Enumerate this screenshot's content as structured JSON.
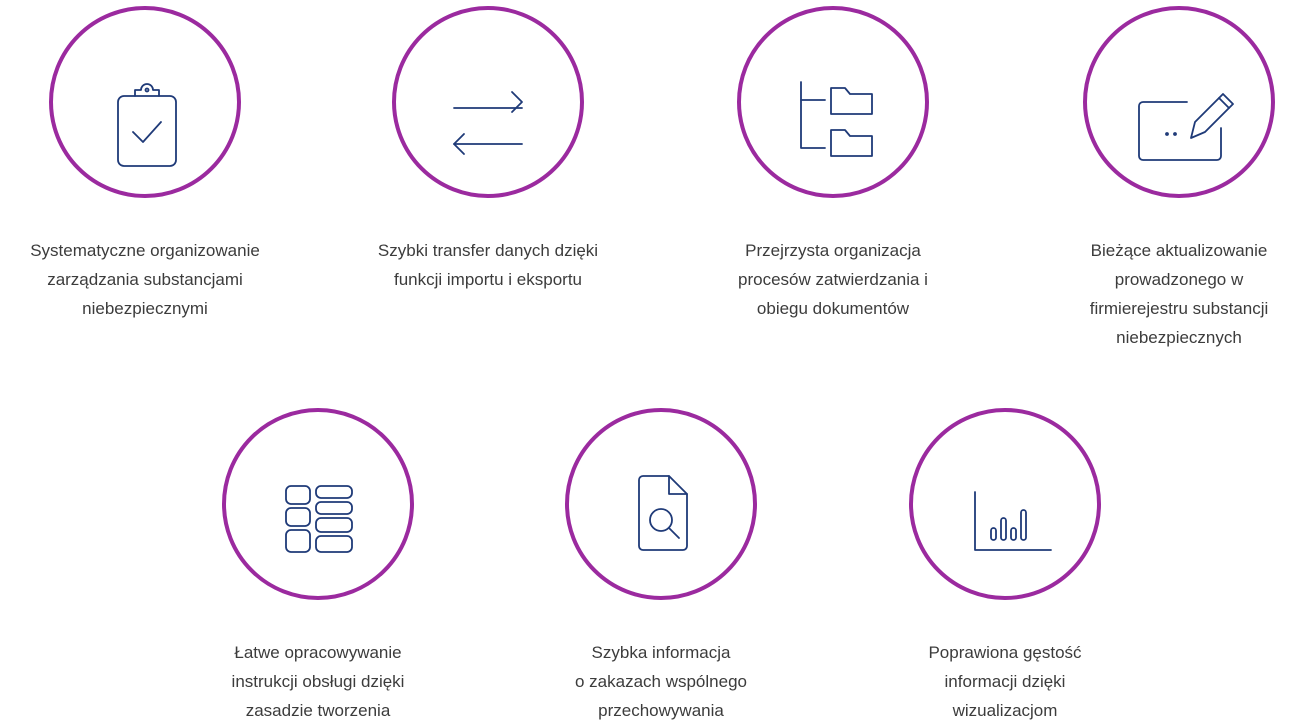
{
  "features": [
    {
      "icon": "clipboard-check-icon",
      "lines": [
        "Systematyczne organizowanie",
        "zarządzania substancjami",
        "niebezpiecznymi"
      ]
    },
    {
      "icon": "transfer-arrows-icon",
      "lines": [
        "Szybki transfer danych dzięki",
        "funkcji importu i eksportu"
      ]
    },
    {
      "icon": "folder-tree-icon",
      "lines": [
        "Przejrzysta organizacja",
        "procesów zatwierdzania i",
        "obiegu dokumentów"
      ]
    },
    {
      "icon": "edit-pencil-icon",
      "lines": [
        "Bieżące aktualizowanie",
        "prowadzonego w",
        "firmierejestru substancji",
        "niebezpiecznych"
      ]
    },
    {
      "icon": "layout-grid-icon",
      "lines": [
        "Łatwe opracowywanie",
        "instrukcji obsługi dzięki",
        "zasadzie tworzenia"
      ]
    },
    {
      "icon": "document-search-icon",
      "lines": [
        "Szybka informacja",
        "o zakazach wspólnego",
        "przechowywania"
      ]
    },
    {
      "icon": "bar-chart-icon",
      "lines": [
        "Poprawiona gęstość",
        "informacji dzięki",
        "wizualizacjom"
      ]
    }
  ],
  "colors": {
    "ring": "#9b2a9f",
    "icon": "#1f3a78",
    "text": "#3c3c3c"
  }
}
